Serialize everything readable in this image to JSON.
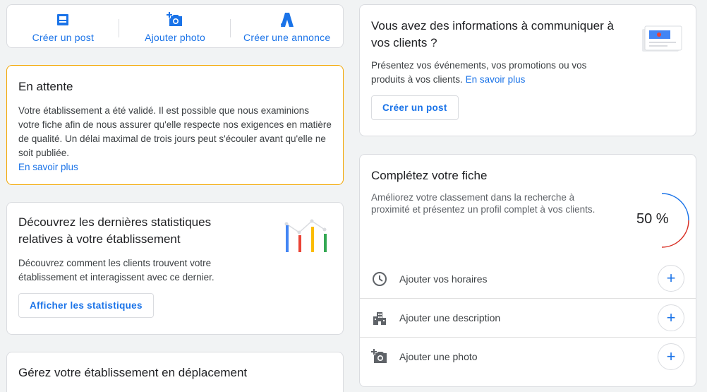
{
  "actions": [
    {
      "label": "Créer un post",
      "icon": "post-icon"
    },
    {
      "label": "Ajouter photo",
      "icon": "add-photo-icon"
    },
    {
      "label": "Créer une annonce",
      "icon": "ads-icon"
    }
  ],
  "pending": {
    "title": "En attente",
    "body": "Votre établissement a été validé. Il est possible que nous examinions votre fiche afin de nous assurer qu'elle respecte nos exigences en matière de qualité. Un délai maximal de trois jours peut s'écouler avant qu'elle ne soit publiée.",
    "link": "En savoir plus"
  },
  "stats": {
    "title": "Découvrez les dernières statistiques relatives à votre établissement",
    "body": "Découvrez comment les clients trouvent votre établissement et interagissent avec ce dernier.",
    "button": "Afficher les statistiques"
  },
  "mobile": {
    "title": "Gérez votre établissement en déplacement"
  },
  "info": {
    "title": "Vous avez des informations à communiquer à vos clients ?",
    "body": "Présentez vos événements, vos promotions ou vos produits à vos clients.",
    "link": "En savoir plus",
    "button": "Créer un post"
  },
  "complete": {
    "title": "Complétez votre fiche",
    "body": "Améliorez votre classement dans la recherche à proximité et présentez un profil complet à vos clients.",
    "percent": "50 %",
    "progress_fraction": 0.5,
    "items": [
      {
        "label": "Ajouter vos horaires",
        "icon": "clock-icon"
      },
      {
        "label": "Ajouter une description",
        "icon": "building-icon"
      },
      {
        "label": "Ajouter une photo",
        "icon": "add-photo-icon"
      }
    ],
    "add_symbol": "+"
  },
  "colors": {
    "accent": "#1a73e8",
    "pending_border": "#f2a600",
    "progress_red": "#d93025"
  }
}
